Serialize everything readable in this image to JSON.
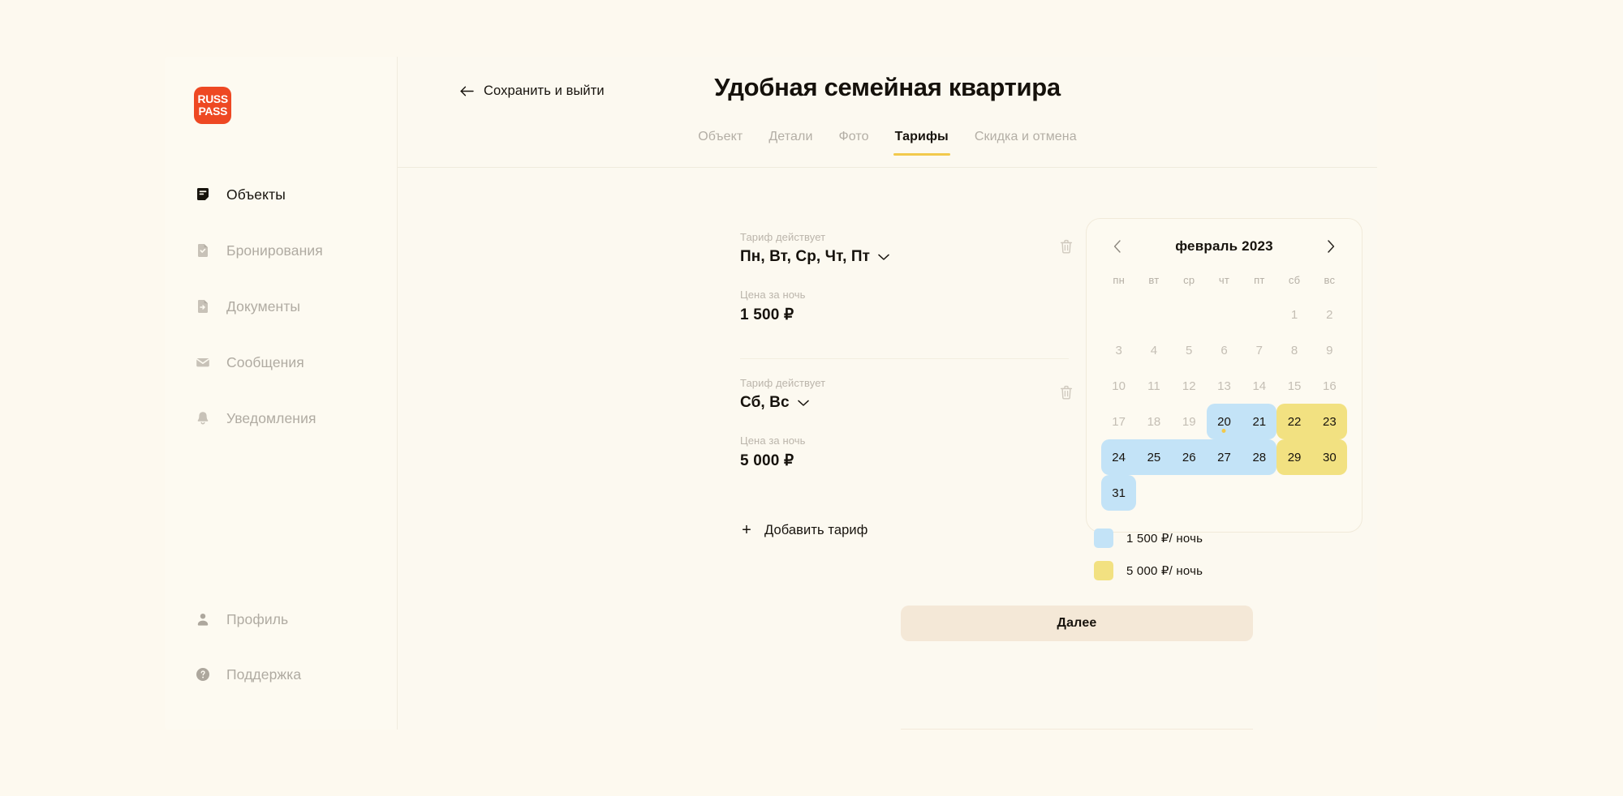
{
  "brand": {
    "logo_line1": "RUSS",
    "logo_line2": "PASS"
  },
  "sidebar": {
    "items": [
      {
        "label": "Объекты",
        "icon": "objects-icon",
        "active": true
      },
      {
        "label": "Бронирования",
        "icon": "bookings-icon",
        "active": false
      },
      {
        "label": "Документы",
        "icon": "documents-icon",
        "active": false
      },
      {
        "label": "Сообщения",
        "icon": "messages-icon",
        "active": false
      },
      {
        "label": "Уведомления",
        "icon": "bell-icon",
        "active": false
      }
    ],
    "bottom_items": [
      {
        "label": "Профиль",
        "icon": "person-icon"
      },
      {
        "label": "Поддержка",
        "icon": "help-circle-icon"
      }
    ]
  },
  "header": {
    "back_label": "Сохранить и выйти",
    "title": "Удобная семейная квартира",
    "tabs": [
      {
        "label": "Объект",
        "active": false
      },
      {
        "label": "Детали",
        "active": false
      },
      {
        "label": "Фото",
        "active": false
      },
      {
        "label": "Тарифы",
        "active": true
      },
      {
        "label": "Скидка и отмена",
        "active": false
      }
    ]
  },
  "tariffs": {
    "days_label": "Тариф действует",
    "price_label": "Цена за ночь",
    "items": [
      {
        "days": "Пн, Вт, Ср, Чт, Пт",
        "price": "1 500 ₽"
      },
      {
        "days": "Сб, Вс",
        "price": "5 000 ₽"
      }
    ],
    "add_label": "Добавить тариф",
    "add_plus": "+"
  },
  "calendar": {
    "month": "февраль 2023",
    "prev_glyph": "‹",
    "next_glyph": "›",
    "weekdays": [
      "пн",
      "вт",
      "ср",
      "чт",
      "пт",
      "сб",
      "вс"
    ],
    "leading_blanks": 5,
    "days": [
      {
        "n": "1",
        "state": "muted"
      },
      {
        "n": "2",
        "state": "muted"
      },
      {
        "n": "3",
        "state": "muted"
      },
      {
        "n": "4",
        "state": "muted"
      },
      {
        "n": "5",
        "state": "muted"
      },
      {
        "n": "6",
        "state": "muted"
      },
      {
        "n": "7",
        "state": "muted"
      },
      {
        "n": "8",
        "state": "muted"
      },
      {
        "n": "9",
        "state": "muted"
      },
      {
        "n": "10",
        "state": "muted"
      },
      {
        "n": "11",
        "state": "muted"
      },
      {
        "n": "12",
        "state": "muted"
      },
      {
        "n": "13",
        "state": "muted"
      },
      {
        "n": "14",
        "state": "muted"
      },
      {
        "n": "15",
        "state": "muted"
      },
      {
        "n": "16",
        "state": "muted"
      },
      {
        "n": "17",
        "state": "muted"
      },
      {
        "n": "18",
        "state": "muted"
      },
      {
        "n": "19",
        "state": "muted"
      },
      {
        "n": "20",
        "state": "blue",
        "round": "start",
        "dot": true
      },
      {
        "n": "21",
        "state": "blue",
        "round": "end"
      },
      {
        "n": "22",
        "state": "yellow",
        "round": "start"
      },
      {
        "n": "23",
        "state": "yellow",
        "round": "end"
      },
      {
        "n": "24",
        "state": "blue",
        "round": "start"
      },
      {
        "n": "25",
        "state": "blue"
      },
      {
        "n": "26",
        "state": "blue"
      },
      {
        "n": "27",
        "state": "blue"
      },
      {
        "n": "28",
        "state": "blue",
        "round": "end"
      },
      {
        "n": "29",
        "state": "yellow",
        "round": "start"
      },
      {
        "n": "30",
        "state": "yellow",
        "round": "end"
      },
      {
        "n": "31",
        "state": "blue",
        "round": "both"
      }
    ]
  },
  "legend": [
    {
      "color": "#C3E3F7",
      "text": "1 500 ₽/ ночь"
    },
    {
      "color": "#F2E181",
      "text": "5 000 ₽/ ночь"
    }
  ],
  "footer": {
    "next_label": "Далее"
  },
  "colors": {
    "page_bg": "#FDF9EF",
    "brand_red": "#EE4823",
    "accent_yellow": "#F2C94C",
    "rate_blue": "#C3E3F7",
    "rate_yellow": "#F2E181",
    "button_bg": "#F4E8D7"
  }
}
